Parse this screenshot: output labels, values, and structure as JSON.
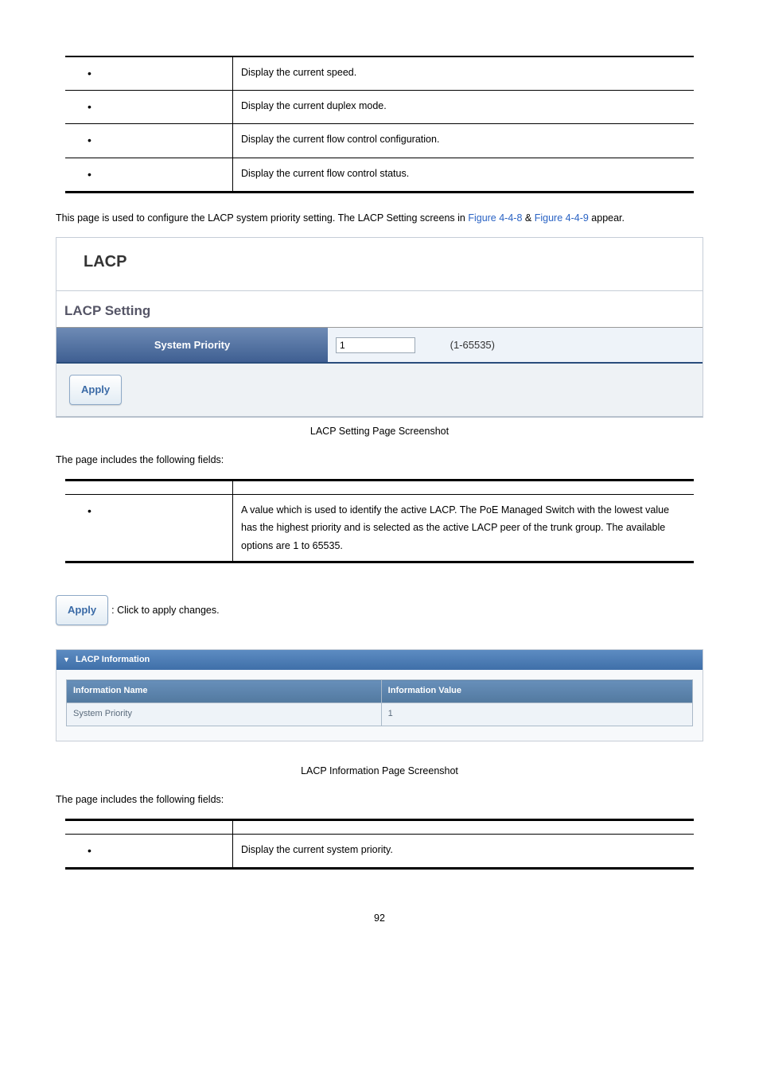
{
  "prop_table": {
    "rows": [
      {
        "label": "",
        "desc": "Display the current speed."
      },
      {
        "label": "",
        "desc": "Display the current duplex mode."
      },
      {
        "label": "",
        "desc": "Display the current flow control configuration."
      },
      {
        "label": "",
        "desc": "Display the current flow control status."
      }
    ]
  },
  "intro": {
    "text_a": "This page is used to configure the LACP system priority setting. The LACP Setting screens in ",
    "link1": "Figure 4-4-8",
    "amp": " & ",
    "link2": "Figure 4-4-9",
    "text_b": " appear."
  },
  "panel": {
    "title": "LACP",
    "section": "LACP Setting",
    "col_label": "System Priority",
    "input_value": "1",
    "range": "(1-65535)",
    "apply": "Apply"
  },
  "caption1": "LACP Setting Page Screenshot",
  "fields_intro": "The page includes the following fields:",
  "fields_table": {
    "rows": [
      {
        "label": "",
        "desc": "A value which is used to identify the active LACP. The PoE Managed Switch with the lowest value has the highest priority and is selected as the active LACP peer of the trunk group. The available options are 1 to 65535."
      }
    ]
  },
  "apply_line": {
    "button": "Apply",
    "text": ": Click to apply changes."
  },
  "infoshot": {
    "header": "LACP Information",
    "col_name": "Information Name",
    "col_value": "Information Value",
    "row_name": "System Priority",
    "row_value": "1"
  },
  "caption2": "LACP Information Page Screenshot",
  "fields_intro2": "The page includes the following fields:",
  "fields_table2": {
    "rows": [
      {
        "label": "",
        "desc": "Display the current system priority."
      }
    ]
  },
  "page_number": "92"
}
